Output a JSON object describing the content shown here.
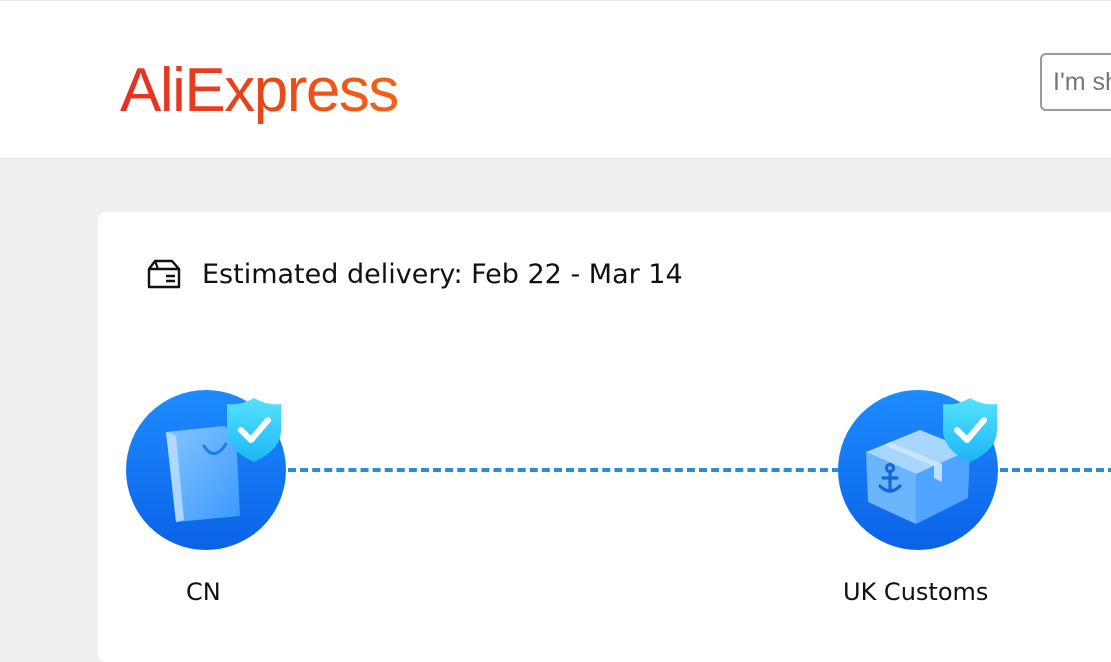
{
  "header": {
    "logo_text": "AliExpress",
    "search": {
      "placeholder": "I'm shopping for..."
    }
  },
  "delivery": {
    "estimated_label": "Estimated delivery: Feb 22 - Mar 14"
  },
  "tracking": {
    "steps": [
      {
        "label": "CN",
        "icon": "shopping-bag-icon",
        "status": "completed"
      },
      {
        "label": "UK Customs",
        "icon": "customs-box-icon",
        "status": "completed"
      }
    ]
  },
  "colors": {
    "brand": "#e62e04",
    "accent_blue": "#1677ff",
    "dash_blue": "#2d8cd6",
    "check_cyan": "#3ad6ff"
  }
}
